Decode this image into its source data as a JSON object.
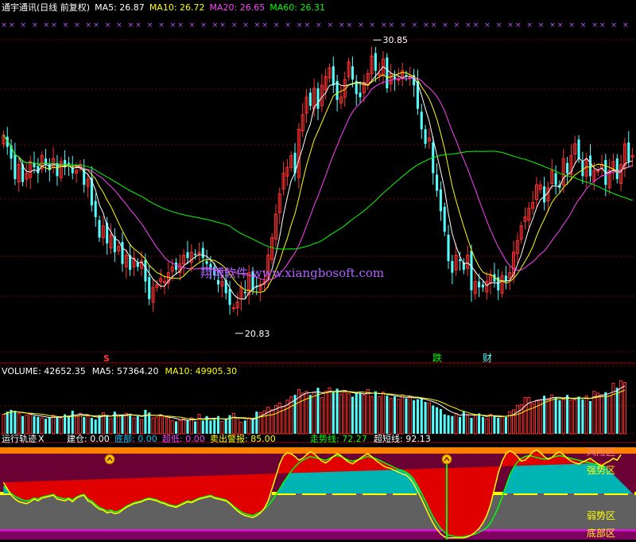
{
  "header": {
    "title": "通宇通讯(日线 前复权)",
    "ma5_label": "MA5: 26.87",
    "ma10_label": "MA10: 26.72",
    "ma20_label": "MA20: 26.65",
    "ma60_label": "MA60: 26.31"
  },
  "volume_header": {
    "vol_label": "VOLUME: 42652.35",
    "ma5_label": "MA5: 57364.20",
    "ma10_label": "MA10: 49905.30"
  },
  "indicator_header": {
    "name": "运行轨迹",
    "close_symbol": "X",
    "items": [
      {
        "text": "建仓: 0.00",
        "color": "#ffffff"
      },
      {
        "text": "底部: 0.00",
        "color": "#00c8ff"
      },
      {
        "text": "超低: 0.00",
        "color": "#ff40ff"
      },
      {
        "text": "卖出警报: 85.00",
        "color": "#ffff00"
      },
      {
        "text": "走势线: 72.27",
        "color": "#00ff00"
      },
      {
        "text": "超短线: 92.13",
        "color": "#ffffff"
      }
    ]
  },
  "annotations": {
    "high_label": "30.85",
    "low_label": "20.83",
    "signal_die": "跌",
    "signal_cai": "财",
    "signal_s": "S",
    "watermark": "翔博软件 www.xiangbosoft.com"
  },
  "zones": {
    "risk": "风险区",
    "strong": "强势区",
    "weak": "弱势区",
    "bottom": "底部区"
  },
  "colors": {
    "up": "#ff3232",
    "down": "#54ffff",
    "ma5": "#ffffff",
    "ma10": "#ffff00",
    "ma20": "#ff40ff",
    "ma60": "#00ff00",
    "risk_zone": "#6b0034",
    "weak_zone": "#606060",
    "strong_fill": "#00b4b4",
    "grid_dash": "#800000"
  },
  "chart_data": {
    "type": "candlestick",
    "series_names": [
      "MA5",
      "MA10",
      "MA20",
      "MA60"
    ],
    "price_ylim": [
      20.2,
      31.4
    ],
    "price_ticks": [],
    "closes": [
      27.6,
      27.2,
      26.8,
      26.1,
      26.6,
      26.0,
      26.3,
      26.7,
      26.5,
      26.3,
      26.9,
      26.6,
      26.4,
      26.8,
      26.2,
      26.7,
      26.5,
      26.6,
      26.3,
      26.4,
      26.6,
      25.9,
      26.1,
      25.2,
      24.8,
      24.1,
      24.5,
      23.9,
      24.2,
      23.6,
      23.8,
      23.2,
      23.5,
      23.0,
      23.4,
      23.1,
      23.3,
      22.6,
      22.0,
      22.4,
      22.5,
      22.7,
      22.6,
      22.9,
      23.1,
      23.0,
      23.2,
      23.5,
      23.4,
      23.6,
      23.5,
      23.6,
      23.4,
      23.2,
      23.0,
      22.8,
      22.5,
      22.6,
      22.2,
      21.8,
      21.7,
      21.9,
      22.4,
      22.2,
      22.9,
      22.3,
      22.4,
      22.5,
      22.6,
      23.5,
      24.1,
      24.9,
      25.6,
      26.3,
      26.5,
      26.9,
      26.3,
      27.8,
      28.3,
      28.9,
      28.6,
      29.2,
      28.5,
      29.3,
      29.6,
      29.9,
      29.3,
      28.8,
      28.9,
      29.5,
      30.1,
      29.5,
      29.0,
      28.9,
      29.4,
      29.7,
      30.3,
      29.8,
      29.7,
      30.2,
      29.2,
      29.7,
      29.5,
      29.5,
      29.8,
      29.6,
      29.6,
      29.3,
      28.5,
      27.8,
      27.3,
      27.5,
      26.3,
      25.7,
      25.0,
      24.3,
      23.3,
      22.9,
      23.5,
      23.3,
      23.0,
      23.5,
      22.3,
      22.6,
      22.4,
      22.4,
      22.6,
      22.8,
      22.6,
      22.3,
      22.8,
      22.6,
      22.9,
      23.6,
      24.0,
      24.5,
      24.8,
      25.1,
      25.3,
      25.9,
      25.9,
      25.3,
      25.8,
      26.4,
      25.9,
      25.8,
      26.8,
      26.3,
      26.9,
      27.3,
      26.8,
      26.2,
      26.8,
      26.2,
      26.4,
      26.4,
      26.6,
      25.9,
      26.4,
      26.7,
      26.1,
      26.6,
      27.3,
      26.7,
      26.9
    ],
    "volumes": [
      22,
      25,
      27,
      26,
      23,
      20,
      21,
      22,
      20,
      19,
      18,
      17,
      18,
      21,
      19,
      18,
      22,
      20,
      26,
      20,
      23,
      19,
      20,
      18,
      16,
      21,
      24,
      21,
      17,
      25,
      20,
      22,
      23,
      21,
      18,
      20,
      16,
      27,
      24,
      18,
      19,
      20,
      19,
      18,
      15,
      14,
      15,
      17,
      15,
      18,
      14,
      22,
      15,
      20,
      15,
      16,
      20,
      14,
      16,
      21,
      23,
      18,
      13,
      15,
      18,
      17,
      25,
      24,
      26,
      30,
      27,
      32,
      35,
      31,
      38,
      42,
      44,
      50,
      46,
      48,
      44,
      47,
      52,
      41,
      48,
      52,
      47,
      51,
      45,
      49,
      46,
      42,
      47,
      46,
      44,
      50,
      42,
      48,
      42,
      47,
      43,
      40,
      42,
      39,
      44,
      40,
      42,
      38,
      39,
      40,
      36,
      35,
      32,
      30,
      28,
      22,
      21,
      20,
      23,
      19,
      25,
      21,
      18,
      21,
      23,
      19,
      17,
      22,
      20,
      18,
      20,
      19,
      25,
      27,
      32,
      33,
      41,
      41,
      34,
      38,
      38,
      43,
      40,
      44,
      41,
      38,
      39,
      44,
      38,
      38,
      42,
      39,
      43,
      37,
      48,
      46,
      44,
      47,
      43,
      57,
      52,
      60,
      58
    ],
    "indicator_ylim": [
      0,
      100
    ],
    "trend_line": [
      58,
      54,
      50,
      47,
      45,
      43,
      42,
      43,
      45,
      44,
      46,
      47,
      48,
      49,
      46,
      45,
      44,
      45,
      43,
      46,
      48,
      49,
      44,
      42,
      38,
      35,
      33,
      31,
      32,
      30,
      31,
      33,
      36,
      38,
      40,
      41,
      42,
      44,
      45,
      44,
      43,
      41,
      40,
      38,
      37,
      36,
      38,
      40,
      42,
      41,
      43,
      45,
      46,
      47,
      48,
      46,
      45,
      44,
      43,
      40,
      36,
      33,
      30,
      28,
      27,
      26,
      28,
      30,
      33,
      37,
      42,
      48,
      55,
      62,
      68,
      74,
      79,
      83,
      86,
      88,
      90,
      89,
      88,
      87,
      86,
      88,
      90,
      91,
      90,
      88,
      86,
      85,
      86,
      87,
      89,
      90,
      89,
      88,
      86,
      84,
      82,
      80,
      78,
      76,
      75,
      73,
      70,
      65,
      58,
      50,
      42,
      33,
      25,
      18,
      12,
      8,
      5,
      4,
      3,
      3,
      3,
      4,
      5,
      6,
      8,
      10,
      13,
      18,
      26,
      35,
      46,
      58,
      70,
      78,
      84,
      88,
      90,
      91,
      90,
      89,
      88,
      87,
      88,
      89,
      90,
      91,
      90,
      89,
      88,
      87,
      86,
      85,
      84,
      83,
      82,
      81,
      80,
      79
    ],
    "short_line": [
      62,
      55,
      48,
      44,
      41,
      40,
      39,
      41,
      44,
      42,
      45,
      46,
      47,
      48,
      44,
      43,
      42,
      44,
      41,
      45,
      47,
      48,
      42,
      40,
      36,
      33,
      32,
      29,
      30,
      28,
      29,
      32,
      35,
      37,
      39,
      40,
      41,
      43,
      44,
      43,
      42,
      40,
      39,
      37,
      36,
      35,
      37,
      39,
      41,
      40,
      42,
      44,
      45,
      46,
      47,
      45,
      44,
      43,
      42,
      39,
      35,
      31,
      28,
      26,
      25,
      24,
      26,
      29,
      34,
      42,
      55,
      68,
      82,
      91,
      94,
      93,
      90,
      86,
      88,
      92,
      95,
      93,
      89,
      85,
      83,
      86,
      90,
      93,
      91,
      87,
      84,
      82,
      85,
      88,
      91,
      93,
      90,
      86,
      83,
      80,
      78,
      77,
      75,
      73,
      71,
      70,
      66,
      60,
      52,
      44,
      35,
      26,
      18,
      11,
      6,
      3,
      2,
      2,
      2,
      2,
      2,
      3,
      5,
      8,
      12,
      18,
      26,
      38,
      55,
      72,
      85,
      93,
      96,
      94,
      90,
      85,
      86,
      90,
      95,
      97,
      94,
      90,
      87,
      89,
      93,
      95,
      92,
      88,
      85,
      83,
      82,
      84,
      86,
      88,
      85,
      82,
      80,
      83,
      85,
      88,
      86,
      92
    ]
  }
}
